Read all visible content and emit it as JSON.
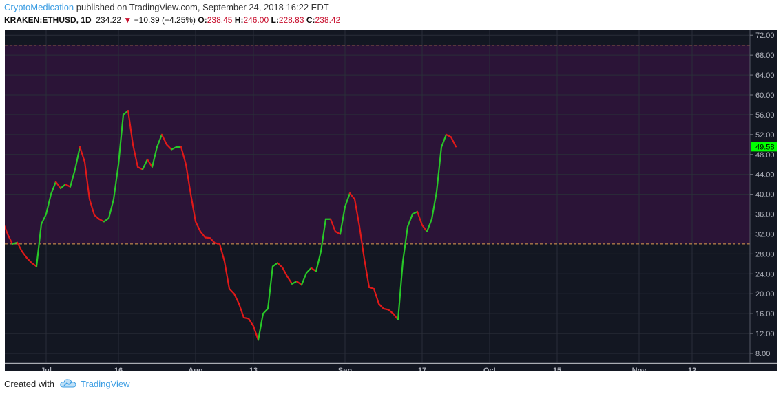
{
  "header": {
    "author": "CryptoMedication",
    "published": "published on TradingView.com, September 24, 2018 16:22 EDT"
  },
  "symbol_bar": {
    "symbol": "KRAKEN:ETHUSD, 1D",
    "price": "234.22",
    "change_arrow": "▼",
    "change": "−10.39 (−4.25%)",
    "open_label": "O:",
    "open": "238.45",
    "high_label": "H:",
    "high": "246.00",
    "low_label": "L:",
    "low": "228.83",
    "close_label": "C:",
    "close": "238.42"
  },
  "footer": {
    "created_with": "Created with",
    "brand": "TradingView",
    "logo_icon": "cloud-logo-icon"
  },
  "colors": {
    "background": "#131722",
    "overbought_zone": "#2b1437",
    "rising": "#28c828",
    "falling": "#e01919",
    "level_line": "#e0a050",
    "last_value_bg": "#00ff00"
  },
  "chart_data": {
    "type": "line",
    "indicator": "oscillator",
    "ylim": [
      8,
      73
    ],
    "yticks": [
      "8.00",
      "12.00",
      "16.00",
      "20.00",
      "24.00",
      "28.00",
      "32.00",
      "36.00",
      "40.00",
      "44.00",
      "48.00",
      "52.00",
      "56.00",
      "60.00",
      "64.00",
      "68.00",
      "72.00"
    ],
    "levels": [
      70,
      30
    ],
    "shaded_band": [
      30,
      70
    ],
    "last_value_label": "49.58",
    "x_ticks": [
      {
        "label": "Jul",
        "day": 0
      },
      {
        "label": "16",
        "day": 15
      },
      {
        "label": "Aug",
        "day": 31
      },
      {
        "label": "13",
        "day": 43
      },
      {
        "label": "Sep",
        "day": 62
      },
      {
        "label": "17",
        "day": 78
      },
      {
        "label": "Oct",
        "day": 92
      },
      {
        "label": "15",
        "day": 106
      },
      {
        "label": "Nov",
        "day": 123
      },
      {
        "label": "12",
        "day": 134
      }
    ],
    "series": [
      {
        "start_day": -9,
        "values": [
          34.5,
          32.0,
          30.0,
          30.3,
          28.5,
          27.2,
          26.2,
          25.5,
          34.0,
          36.0,
          40.0,
          42.5,
          41.2,
          42.0,
          41.5,
          45.0,
          49.5,
          46.5,
          39.0,
          35.8,
          35.0,
          34.5,
          35.2,
          39.0,
          46.0,
          56.0,
          56.8,
          50.0,
          45.5,
          45.0,
          47.0,
          45.5,
          49.5,
          52.0,
          50.0,
          49.0,
          49.5,
          49.5,
          46.0,
          40.0,
          34.5,
          32.5,
          31.3,
          31.2,
          30.2,
          30.0,
          26.5,
          21.0,
          20.0,
          18.0,
          15.2,
          15.0,
          13.5,
          10.7,
          16.0,
          17.0,
          25.5,
          26.2,
          25.3,
          23.5,
          22.0,
          22.5,
          21.8,
          24.2,
          25.2,
          24.5,
          28.5,
          35.0,
          35.0,
          32.5,
          32.0,
          37.5,
          40.2,
          39.0,
          33.5,
          27.0,
          21.3,
          21.0,
          18.0,
          17.0,
          16.8,
          16.0,
          14.8,
          26.5,
          33.5,
          36.0,
          36.5,
          33.8,
          32.5,
          35.0,
          40.5,
          49.5,
          52.0,
          51.5,
          49.58
        ]
      }
    ]
  }
}
